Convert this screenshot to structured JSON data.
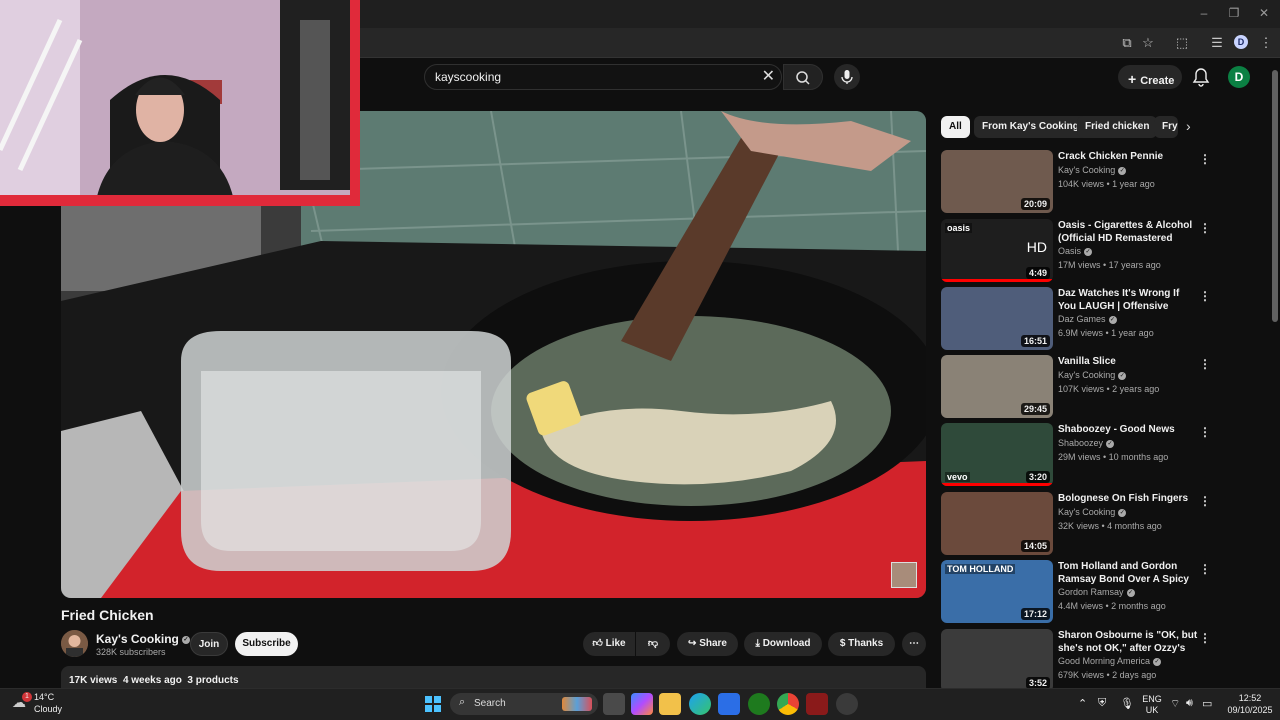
{
  "search": {
    "query": "kayscooking"
  },
  "header": {
    "create_label": "Create",
    "avatar_letter": "D"
  },
  "browser": {
    "profile_letter": "D"
  },
  "video": {
    "title": "Fried Chicken",
    "channel": "Kay's Cooking",
    "subscribers": "328K subscribers",
    "join_label": "Join",
    "subscribe_label": "Subscribe",
    "like_label": "Like",
    "share_label": "Share",
    "download_label": "Download",
    "thanks_label": "Thanks",
    "more_label": "⋯",
    "views": "17K views",
    "age": "4 weeks ago",
    "products": "3 products"
  },
  "chips": [
    "All",
    "From Kay's Cooking",
    "Fried chicken",
    "Fry"
  ],
  "recommendations": [
    {
      "title": "Crack Chicken Pennie",
      "channel": "Kay's Cooking",
      "meta": "104K views • 1 year ago",
      "duration": "20:09",
      "thumb_color": "#6f5a4e",
      "watched": 0
    },
    {
      "title": "Oasis - Cigarettes & Alcohol (Official HD Remastered Video)",
      "channel": "Oasis",
      "meta": "17M views • 17 years ago",
      "duration": "4:49",
      "thumb_color": "#1e1e1e",
      "watched": 1,
      "badge": "oasis",
      "badge2": "HD"
    },
    {
      "title": "Daz Watches It's Wrong If You LAUGH | Offensive",
      "channel": "Daz Games",
      "meta": "6.9M views • 1 year ago",
      "duration": "16:51",
      "thumb_color": "#4f5d7a",
      "watched": 0
    },
    {
      "title": "Vanilla Slice",
      "channel": "Kay's Cooking",
      "meta": "107K views • 2 years ago",
      "duration": "29:45",
      "thumb_color": "#8a8276",
      "watched": 0
    },
    {
      "title": "Shaboozey - Good News",
      "channel": "Shaboozey",
      "meta": "29M views • 10 months ago",
      "duration": "3:20",
      "thumb_color": "#2f4a3a",
      "watched": 1,
      "badge": "vevo"
    },
    {
      "title": "Bolognese On Fish Fingers",
      "channel": "Kay's Cooking",
      "meta": "32K views • 4 months ago",
      "duration": "14:05",
      "thumb_color": "#6b4a3c",
      "watched": 0
    },
    {
      "title": "Tom Holland and Gordon Ramsay Bond Over A Spicy ...",
      "channel": "Gordon Ramsay",
      "meta": "4.4M views • 2 months ago",
      "duration": "17:12",
      "thumb_color": "#3a6ea8",
      "watched": 0,
      "badge": "TOM HOLLAND"
    },
    {
      "title": "Sharon Osbourne is \"OK, but she's not OK,\" after Ozzy's deat...",
      "channel": "Good Morning America",
      "meta": "679K views • 2 days ago",
      "duration": "3:52",
      "thumb_color": "#3b3b3b",
      "watched": 0
    }
  ],
  "taskbar": {
    "weather_temp": "14°C",
    "weather_desc": "Cloudy",
    "search_label": "Search",
    "lang": "ENG",
    "region": "UK",
    "time": "12:52",
    "date": "09/10/2025",
    "notif_count": "1"
  }
}
